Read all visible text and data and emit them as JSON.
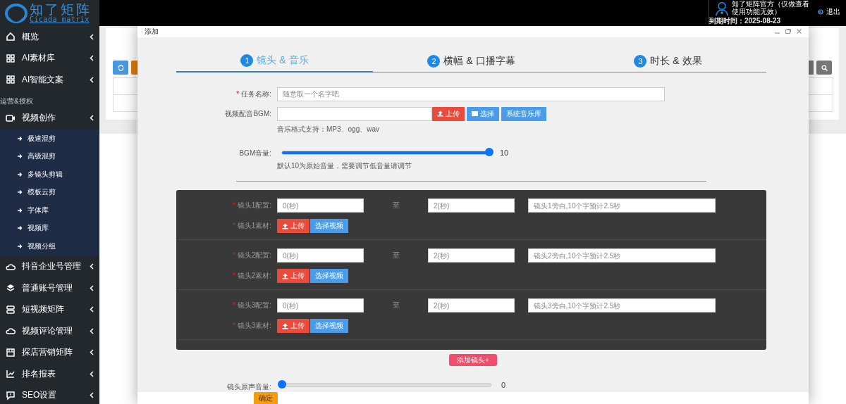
{
  "logo": {
    "name": "知了矩阵",
    "subtitle": "Cicada matrix"
  },
  "sidebar": {
    "items": [
      {
        "kind": "item",
        "label": "概览"
      },
      {
        "kind": "item",
        "label": "AI素材库"
      },
      {
        "kind": "item",
        "label": "AI智能文案"
      },
      {
        "kind": "section",
        "label": "运营&授权"
      },
      {
        "kind": "item",
        "label": "视频创作",
        "expanded": true,
        "children": [
          {
            "label": "极速混剪"
          },
          {
            "label": "高级混剪"
          },
          {
            "label": "多镜头剪辑"
          },
          {
            "label": "模板云剪"
          },
          {
            "label": "字体库"
          },
          {
            "label": "视频库"
          },
          {
            "label": "视频分组"
          }
        ]
      },
      {
        "kind": "item",
        "label": "抖音企业号管理"
      },
      {
        "kind": "item",
        "label": "普通账号管理"
      },
      {
        "kind": "item",
        "label": "短视频矩阵"
      },
      {
        "kind": "item",
        "label": "视频评论管理"
      },
      {
        "kind": "item",
        "label": "探店营销矩阵"
      },
      {
        "kind": "item",
        "label": "排名报表"
      },
      {
        "kind": "item",
        "label": "SEO设置"
      }
    ]
  },
  "header": {
    "user": "知了矩阵官方（仅做查看使用功能无效）",
    "expiry": "到期时间：2025-08-23",
    "logout": "退出"
  },
  "modal": {
    "title": "添加",
    "steps": [
      {
        "number": "1",
        "label": "镜头 & 音乐",
        "selected": true
      },
      {
        "number": "2",
        "label": "横幅 & 口播字幕",
        "selected": false
      },
      {
        "number": "3",
        "label": "时长 & 效果",
        "selected": false
      }
    ],
    "task_name": {
      "required_mark": "*",
      "label": "任务名称:",
      "placeholder": "随意取一个名字吧"
    },
    "bgm": {
      "label": "视频配音BGM:",
      "upload": "上传",
      "choose": "选择",
      "library": "系统音乐库",
      "hint": "音乐格式支持：MP3、ogg、wav"
    },
    "bgm_volume": {
      "label": "BGM音量:",
      "level": 1,
      "reading": "10",
      "hint": "默认10为原始音量，需要调节低音量请调节"
    },
    "shots": [
      {
        "config_required_mark": "*",
        "config_label": "镜头1配置:",
        "start_placeholder": "0(秒)",
        "separator": "至",
        "end_placeholder": "2(秒)",
        "narration_placeholder": "镜头1旁白,10个字预计2.5秒",
        "material_required_mark": "*",
        "material_label": "镜头1素材:",
        "upload": "上传",
        "choose": "选择视频"
      },
      {
        "config_required_mark": "*",
        "config_label": "镜头2配置:",
        "start_placeholder": "0(秒)",
        "separator": "至",
        "end_placeholder": "2(秒)",
        "narration_placeholder": "镜头2旁白,10个字预计2.5秒",
        "material_required_mark": "*",
        "material_label": "镜头2素材:",
        "upload": "上传",
        "choose": "选择视频"
      },
      {
        "config_required_mark": "*",
        "config_label": "镜头3配置:",
        "start_placeholder": "0(秒)",
        "separator": "至",
        "end_placeholder": "2(秒)",
        "narration_placeholder": "镜头3旁白,10个字预计2.5秒",
        "material_required_mark": "*",
        "material_label": "镜头3素材:",
        "upload": "上传",
        "choose": "选择视频"
      }
    ],
    "add_shot": "添加镜头+",
    "original_volume": {
      "label": "镜头原声音量:",
      "level": 0,
      "reading": "0"
    },
    "confirm": "确定"
  }
}
